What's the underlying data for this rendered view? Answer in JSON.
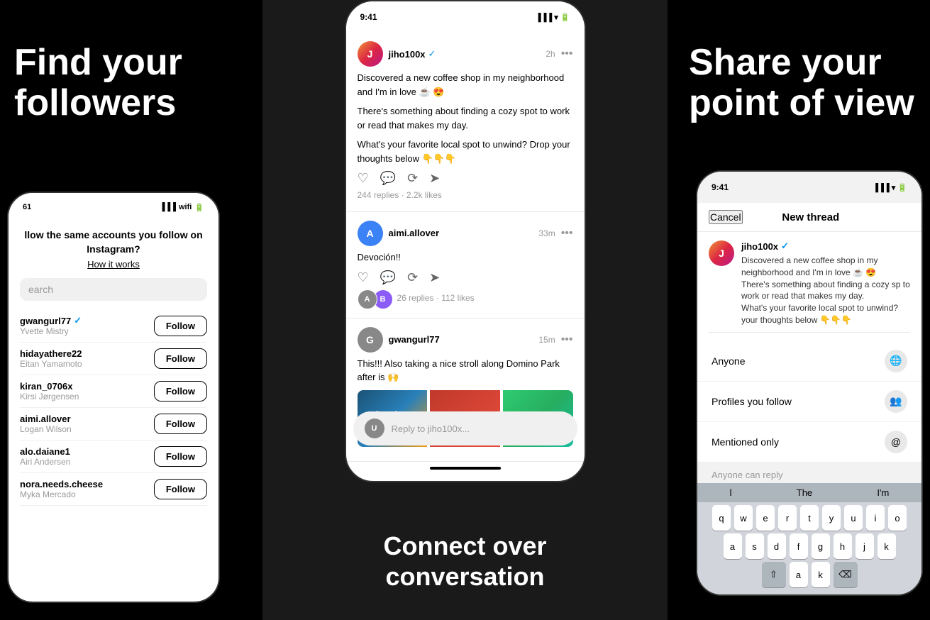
{
  "left": {
    "headline_line1": "Find your",
    "headline_line2": "followers",
    "onboarding_question": "llow the same accounts you follow on Instagram?",
    "how_it_works": "How it works",
    "search_placeholder": "earch",
    "users": [
      {
        "handle": "gwangurl77",
        "verified": true,
        "name": "Yvette Mistry"
      },
      {
        "handle": "hidayathere22",
        "verified": false,
        "name": "Eitan Yamamoto"
      },
      {
        "handle": "kiran_0706x",
        "verified": false,
        "name": "Kirsi Jørgensen"
      },
      {
        "handle": "aimi.allover",
        "verified": false,
        "name": "Logan Wilson"
      },
      {
        "handle": "alo.daiane1",
        "verified": false,
        "name": "Airi Andersen"
      },
      {
        "handle": "nora.needs.cheese",
        "verified": false,
        "name": "Myka Mercado"
      }
    ],
    "follow_label": "Follow",
    "phone_status_time": "61",
    "phone_status_icons": "▐▐▐ ▾ ▬"
  },
  "center": {
    "bottom_text_line1": "Connect over",
    "bottom_text_line2": "conversation",
    "post1": {
      "username": "jiho100x",
      "verified": true,
      "time": "2h",
      "text1": "Discovered a new coffee shop in my neighborhood and I'm in love ☕ 😍",
      "text2": "There's something about finding a cozy spot to work or read that makes my day.",
      "text3": "What's your favorite local spot to unwind? Drop your thoughts below 👇👇👇",
      "stats": "244 replies · 2.2k likes"
    },
    "post2": {
      "username": "aimi.allover",
      "time": "33m",
      "text": "Devoción!!",
      "stats": "26 replies · 112 likes"
    },
    "post3": {
      "username": "gwangurl77",
      "time": "15m",
      "text": "This!!! Also taking a nice stroll along Domino Park after is 🙌",
      "domino_text": "Domino SUGAR"
    },
    "reply_placeholder": "Reply to jiho100x..."
  },
  "right": {
    "headline_line1": "Share your",
    "headline_line2": "point of view",
    "phone_status_time": "9:41",
    "cancel_label": "Cancel",
    "new_thread_label": "New thread",
    "compose": {
      "username": "jiho100x",
      "verified": true,
      "text1": "Discovered a new coffee shop in my neighborhood and I'm in love ☕ 😍",
      "text2": "There's something about finding a cozy sp to work or read that makes my day.",
      "text3": "What's your favorite local spot to unwind? your thoughts below 👇👇👇"
    },
    "reply_options": [
      {
        "label": "Anyone",
        "icon": "🌐"
      },
      {
        "label": "Profiles you follow",
        "icon": "👥"
      },
      {
        "label": "Mentioned only",
        "icon": "@"
      }
    ],
    "anyone_can_reply": "Anyone can reply",
    "keyboard_row1": [
      "q",
      "w",
      "e",
      "r",
      "t",
      "y",
      "u",
      "i",
      "o"
    ],
    "keyboard_row2": [
      "a",
      "s",
      "d",
      "f",
      "g",
      "h",
      "j",
      "k"
    ],
    "keyboard_suggestions": [
      "l",
      "The",
      "I'm"
    ]
  }
}
